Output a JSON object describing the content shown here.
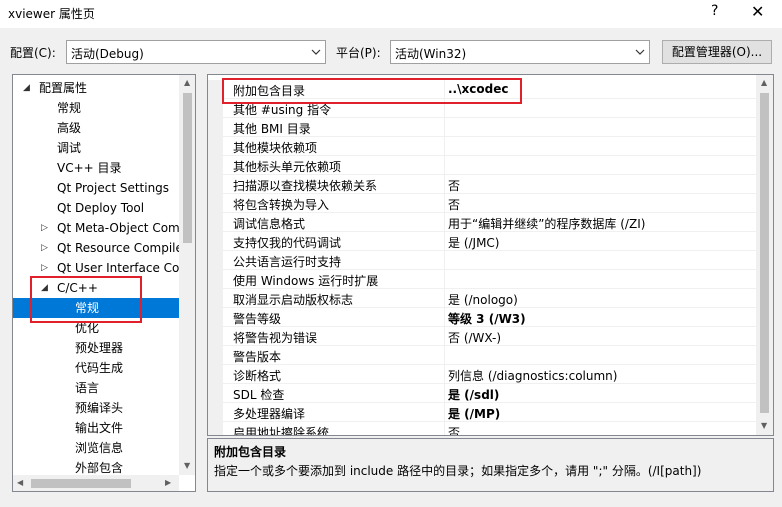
{
  "window": {
    "title": "xviewer 属性页",
    "help_glyph": "?",
    "close_glyph": "✕"
  },
  "config": {
    "label": "配置(C):",
    "value": "活动(Debug)"
  },
  "platform": {
    "label": "平台(P):",
    "value": "活动(Win32)"
  },
  "config_manager_label": "配置管理器(O)...",
  "tree": [
    {
      "label": "配置属性",
      "level": 0,
      "expander": "expanded"
    },
    {
      "label": "常规",
      "level": 1
    },
    {
      "label": "高级",
      "level": 1
    },
    {
      "label": "调试",
      "level": 1
    },
    {
      "label": "VC++ 目录",
      "level": 1
    },
    {
      "label": "Qt Project Settings",
      "level": 1
    },
    {
      "label": "Qt Deploy Tool",
      "level": 1
    },
    {
      "label": "Qt Meta-Object Com",
      "level": 1,
      "expander": "collapsed"
    },
    {
      "label": "Qt Resource Compile",
      "level": 1,
      "expander": "collapsed"
    },
    {
      "label": "Qt User Interface Co",
      "level": 1,
      "expander": "collapsed"
    },
    {
      "label": "C/C++",
      "level": 1,
      "expander": "expanded"
    },
    {
      "label": "常规",
      "level": 2,
      "selected": true
    },
    {
      "label": "优化",
      "level": 2
    },
    {
      "label": "预处理器",
      "level": 2
    },
    {
      "label": "代码生成",
      "level": 2
    },
    {
      "label": "语言",
      "level": 2
    },
    {
      "label": "预编译头",
      "level": 2
    },
    {
      "label": "输出文件",
      "level": 2
    },
    {
      "label": "浏览信息",
      "level": 2
    },
    {
      "label": "外部包含",
      "level": 2
    }
  ],
  "properties": [
    {
      "name": "附加包含目录",
      "value": "..\\xcodec",
      "bold": true
    },
    {
      "name": "其他 #using 指令",
      "value": ""
    },
    {
      "name": "其他 BMI 目录",
      "value": ""
    },
    {
      "name": "其他模块依赖项",
      "value": ""
    },
    {
      "name": "其他标头单元依赖项",
      "value": ""
    },
    {
      "name": "扫描源以查找模块依赖关系",
      "value": "否"
    },
    {
      "name": "将包含转换为导入",
      "value": "否"
    },
    {
      "name": "调试信息格式",
      "value": "用于“编辑并继续”的程序数据库 (/ZI)"
    },
    {
      "name": "支持仅我的代码调试",
      "value": "是 (/JMC)"
    },
    {
      "name": "公共语言运行时支持",
      "value": ""
    },
    {
      "name": "使用 Windows 运行时扩展",
      "value": ""
    },
    {
      "name": "取消显示启动版权标志",
      "value": "是 (/nologo)"
    },
    {
      "name": "警告等级",
      "value": "等级 3 (/W3)",
      "bold": true
    },
    {
      "name": "将警告视为错误",
      "value": "否 (/WX-)"
    },
    {
      "name": "警告版本",
      "value": ""
    },
    {
      "name": "诊断格式",
      "value": "列信息 (/diagnostics:column)"
    },
    {
      "name": "SDL 检查",
      "value": "是 (/sdl)",
      "bold": true
    },
    {
      "name": "多处理器编译",
      "value": "是 (/MP)",
      "bold": true
    },
    {
      "name": "启用地址擦除系统",
      "value": "否"
    }
  ],
  "description": {
    "title": "附加包含目录",
    "text": "指定一个或多个要添加到 include 路径中的目录；如果指定多个，请用 \";\" 分隔。(/I[path])"
  },
  "colors": {
    "selection": "#0078d7",
    "highlight_box": "#e0202a"
  }
}
